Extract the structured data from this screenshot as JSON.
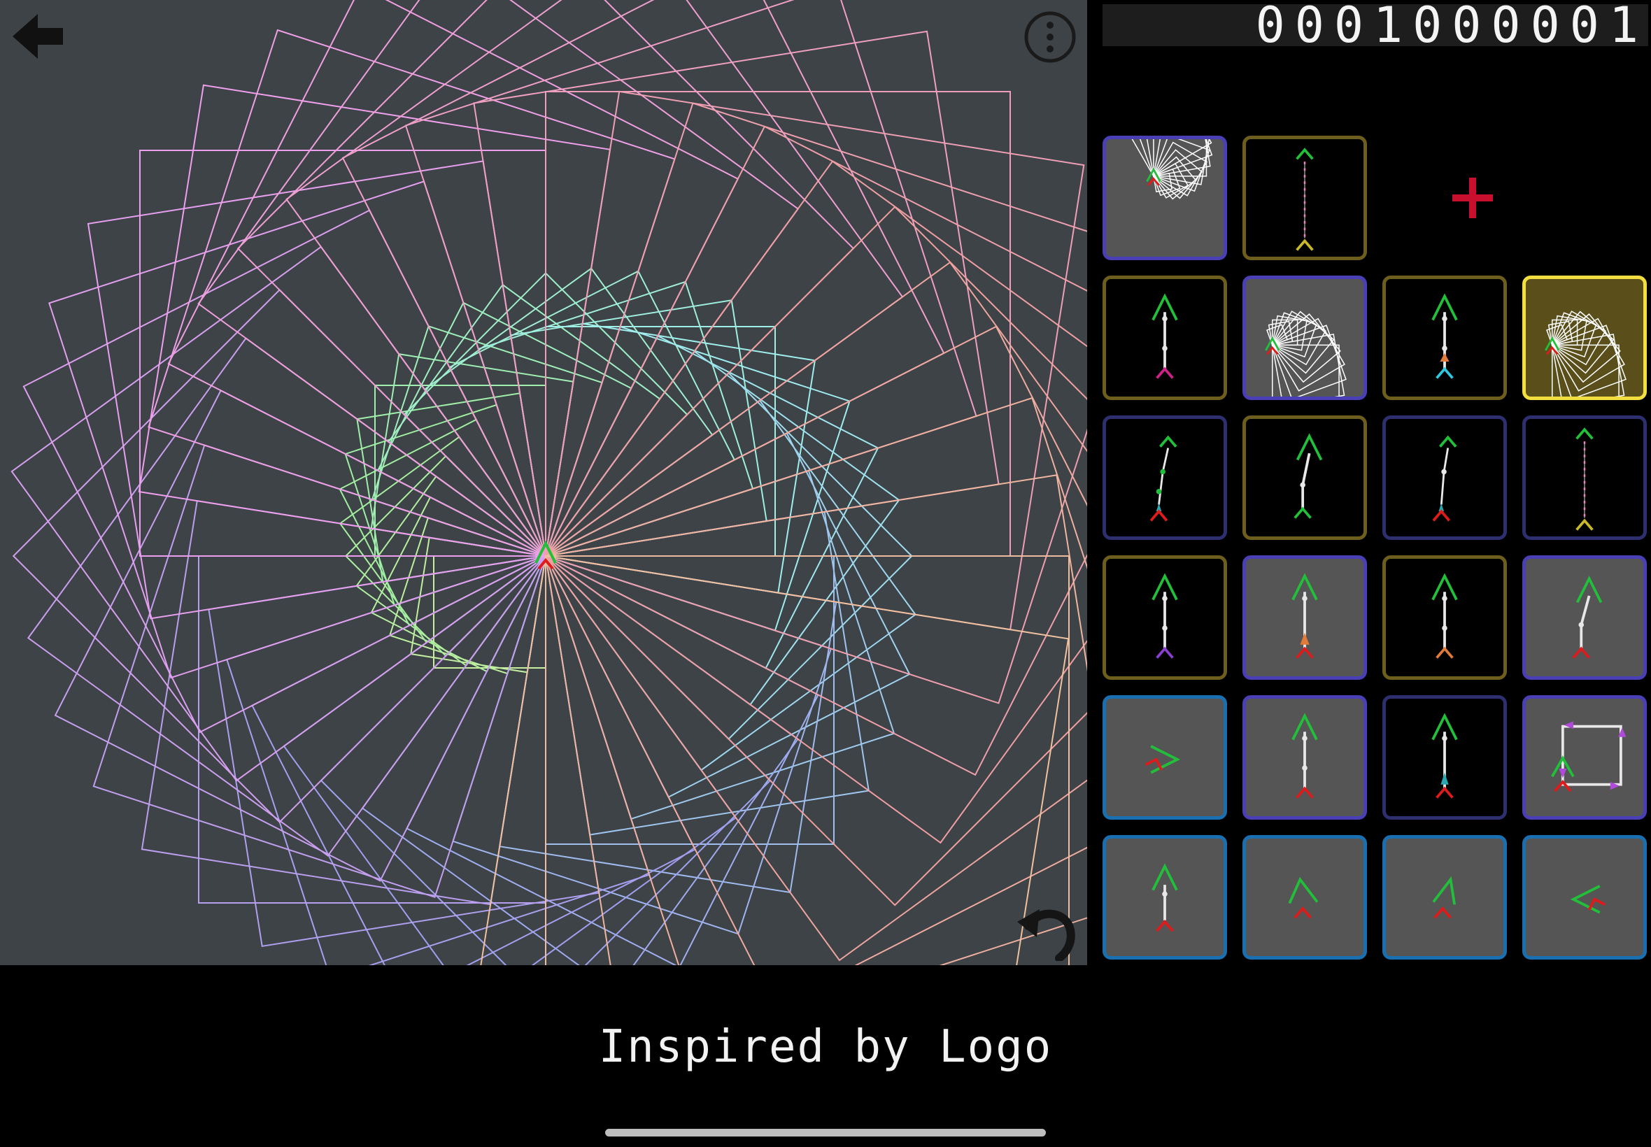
{
  "app": {
    "counter": "0001000001",
    "caption": "Inspired by Logo",
    "back_icon": "back-arrow-icon",
    "menu_icon": "more-vertical-icon",
    "undo_icon": "undo-icon",
    "add_icon": "plus-icon"
  },
  "colors": {
    "canvas": "#3e4347",
    "panel": "#000000",
    "accent_add": "#c8102e",
    "selected_border": "#f2de3e",
    "gold_border": "#6e5e1e",
    "navy_border": "#2d2f6e",
    "purple_border": "#4a3fb5",
    "blue_border": "#1a6fb0",
    "turtle_head": "#22c03a",
    "turtle_tail": "#e01b1b"
  },
  "tiles": [
    {
      "row": 0,
      "col": 0,
      "style": "t-purple",
      "glyph": "spiral-squares",
      "icon": "spiral-squares-icon"
    },
    {
      "row": 0,
      "col": 1,
      "style": "t-gold",
      "glyph": "dotted-line",
      "icon": "dotted-line-icon"
    },
    {
      "row": 1,
      "col": 0,
      "style": "t-gold",
      "glyph": "forward-magenta",
      "icon": "forward-step-icon"
    },
    {
      "row": 1,
      "col": 1,
      "style": "t-purple",
      "glyph": "squares-spin",
      "icon": "square-spiral-icon"
    },
    {
      "row": 1,
      "col": 2,
      "style": "t-gold",
      "glyph": "forward-cyan",
      "icon": "forward-step-icon"
    },
    {
      "row": 1,
      "col": 3,
      "style": "t-sel",
      "glyph": "squares-spin",
      "icon": "square-spiral-icon"
    },
    {
      "row": 2,
      "col": 0,
      "style": "t-navy",
      "glyph": "bend-green",
      "icon": "bend-icon"
    },
    {
      "row": 2,
      "col": 1,
      "style": "t-gold",
      "glyph": "bend-single",
      "icon": "bend-icon"
    },
    {
      "row": 2,
      "col": 2,
      "style": "t-navy",
      "glyph": "bend-cyan",
      "icon": "bend-icon"
    },
    {
      "row": 2,
      "col": 3,
      "style": "t-navy",
      "glyph": "dotted-line",
      "icon": "dotted-line-icon"
    },
    {
      "row": 3,
      "col": 0,
      "style": "t-gold",
      "glyph": "forward-purple",
      "icon": "forward-step-icon"
    },
    {
      "row": 3,
      "col": 1,
      "style": "t-purple",
      "glyph": "forward-orange-red",
      "icon": "forward-step-icon"
    },
    {
      "row": 3,
      "col": 2,
      "style": "t-gold",
      "glyph": "forward-orange",
      "icon": "forward-step-icon"
    },
    {
      "row": 3,
      "col": 3,
      "style": "t-purple",
      "glyph": "bend-red",
      "icon": "bend-icon"
    },
    {
      "row": 4,
      "col": 0,
      "style": "t-blue",
      "glyph": "turn-right",
      "icon": "turn-right-icon"
    },
    {
      "row": 4,
      "col": 1,
      "style": "t-purple",
      "glyph": "forward-red",
      "icon": "forward-step-icon"
    },
    {
      "row": 4,
      "col": 2,
      "style": "t-navy",
      "glyph": "forward-teal-red",
      "icon": "forward-step-icon"
    },
    {
      "row": 4,
      "col": 3,
      "style": "t-purple",
      "glyph": "square-path",
      "icon": "square-path-icon"
    },
    {
      "row": 5,
      "col": 0,
      "style": "t-blue",
      "glyph": "forward-short",
      "icon": "forward-step-icon"
    },
    {
      "row": 5,
      "col": 1,
      "style": "t-blue",
      "glyph": "turtle-tilt-left",
      "icon": "rotate-left-icon"
    },
    {
      "row": 5,
      "col": 2,
      "style": "t-blue",
      "glyph": "turtle-tilt-right",
      "icon": "rotate-right-icon"
    },
    {
      "row": 5,
      "col": 3,
      "style": "t-blue",
      "glyph": "turn-left",
      "icon": "turn-left-icon"
    }
  ]
}
